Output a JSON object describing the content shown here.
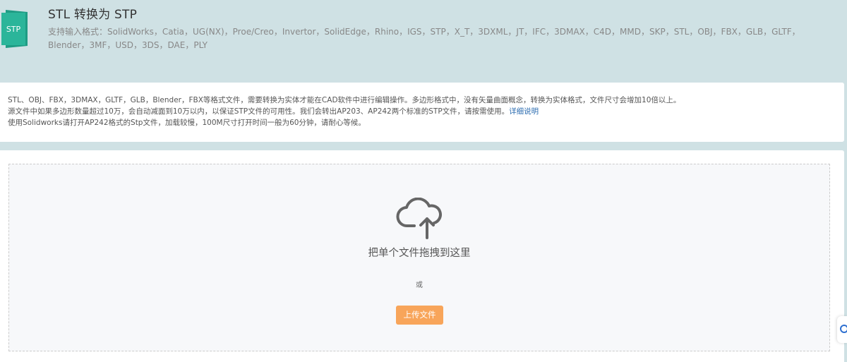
{
  "header": {
    "logo_text": "STP",
    "title": "STL 转换为 STP",
    "formats": "支持输入格式：SolidWorks，Catia，UG(NX)，Proe/Creo，Invertor，SolidEdge，Rhino，IGS，STP，X_T，3DXML，JT，IFC，3DMAX，C4D，MMD，SKP，STL，OBJ，FBX，GLB，GLTF，Blender，3MF，USD，3DS，DAE，PLY"
  },
  "info": {
    "line1": "STL、OBJ、FBX，3DMAX，GLTF，GLB，Blender，FBX等格式文件，需要转换为实体才能在CAD软件中进行编辑操作。多边形格式中，没有矢量曲面概念，转换为实体格式，文件尺寸会增加10倍以上。",
    "line2": "源文件中如果多边形数量超过10万，会自动减面到10万以内，以保证STP文件的可用性。我们会转出AP203、AP242两个标准的STP文件，请按需使用。",
    "line2_link": "详细说明",
    "line3": "使用Solidworks请打开AP242格式的Stp文件，加载较慢，100M尺寸打开时间一般为60分钟，请耐心等候。"
  },
  "upload": {
    "drop_text": "把单个文件拖拽到这里",
    "or_text": "或",
    "button_label": "上传文件",
    "icon": "cloud-upload-icon"
  },
  "colors": {
    "background": "#cfe1e4",
    "logo": "#2bb59a",
    "button": "#f8a55a",
    "link": "#2b6cb0"
  }
}
